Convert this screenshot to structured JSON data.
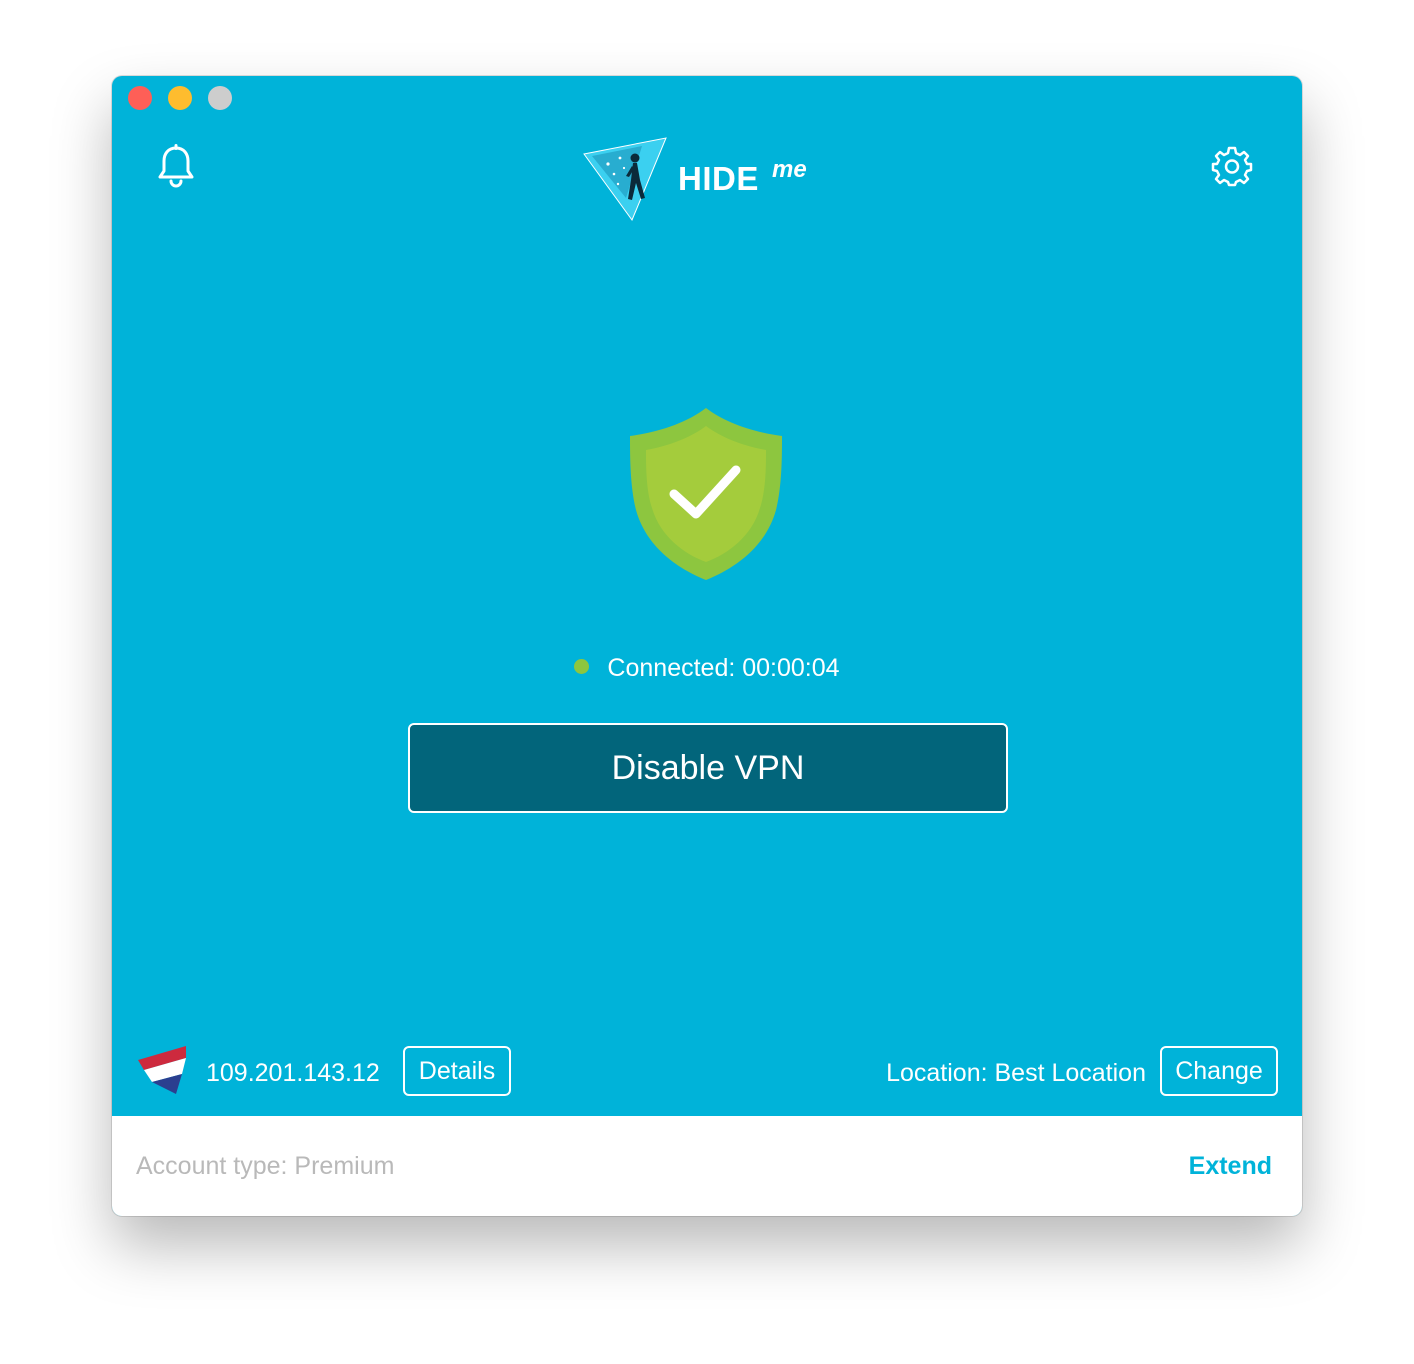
{
  "window": {
    "controls": [
      "close",
      "minimize",
      "zoom"
    ]
  },
  "header": {
    "bell_icon": "bell-icon",
    "settings_icon": "gear-icon",
    "logo": {
      "main": "HIDE",
      "suffix": "me"
    }
  },
  "status": {
    "text": "Connected: 00:00:04",
    "indicator_color": "#8dc63f"
  },
  "actions": {
    "disable_label": "Disable VPN"
  },
  "connection": {
    "ip": "109.201.143.12",
    "details_label": "Details",
    "location_text": "Location: Best Location",
    "change_label": "Change",
    "flag_icon": "netherlands-flag-icon"
  },
  "footer": {
    "account_text": "Account type: Premium",
    "extend_label": "Extend"
  },
  "colors": {
    "background": "#00b3d9",
    "button_dark": "#02657b",
    "shield_outer": "#8dc63f",
    "shield_inner": "#a4cc3c",
    "extend": "#00b3d9",
    "account_text": "#b9b9b9"
  }
}
